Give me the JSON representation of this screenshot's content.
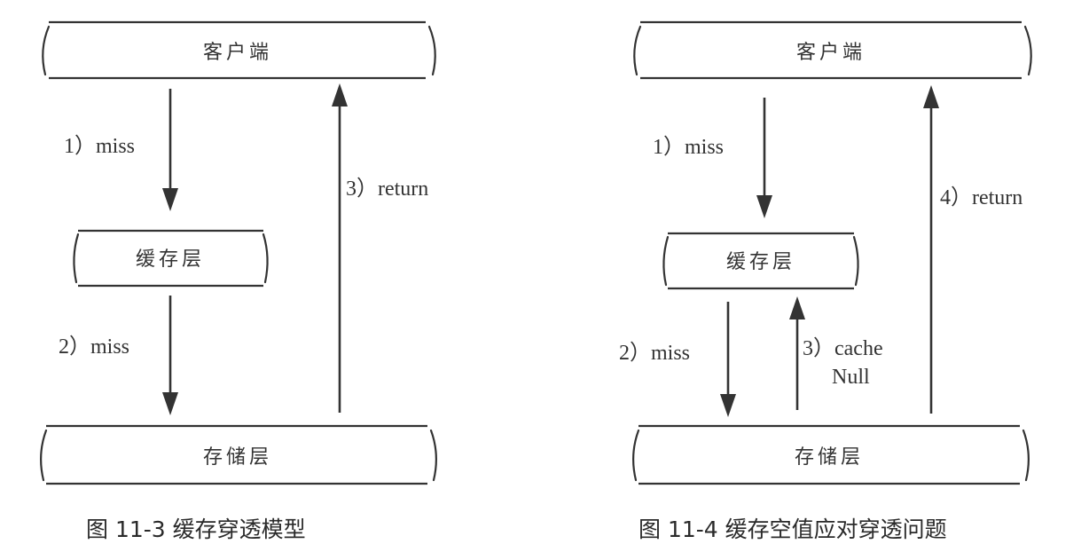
{
  "figure_left": {
    "client": "客户端",
    "cache": "缓存层",
    "storage": "存储层",
    "edge1": "1）miss",
    "edge2": "2）miss",
    "edge3": "3）return",
    "caption": "图 11-3   缓存穿透模型"
  },
  "figure_right": {
    "client": "客户端",
    "cache": "缓存层",
    "storage": "存储层",
    "edge1": "1）miss",
    "edge2": "2）miss",
    "edge3_line1": "3）cache",
    "edge3_line2": "Null",
    "edge4": "4）return",
    "caption": "图 11-4   缓存空值应对穿透问题"
  }
}
